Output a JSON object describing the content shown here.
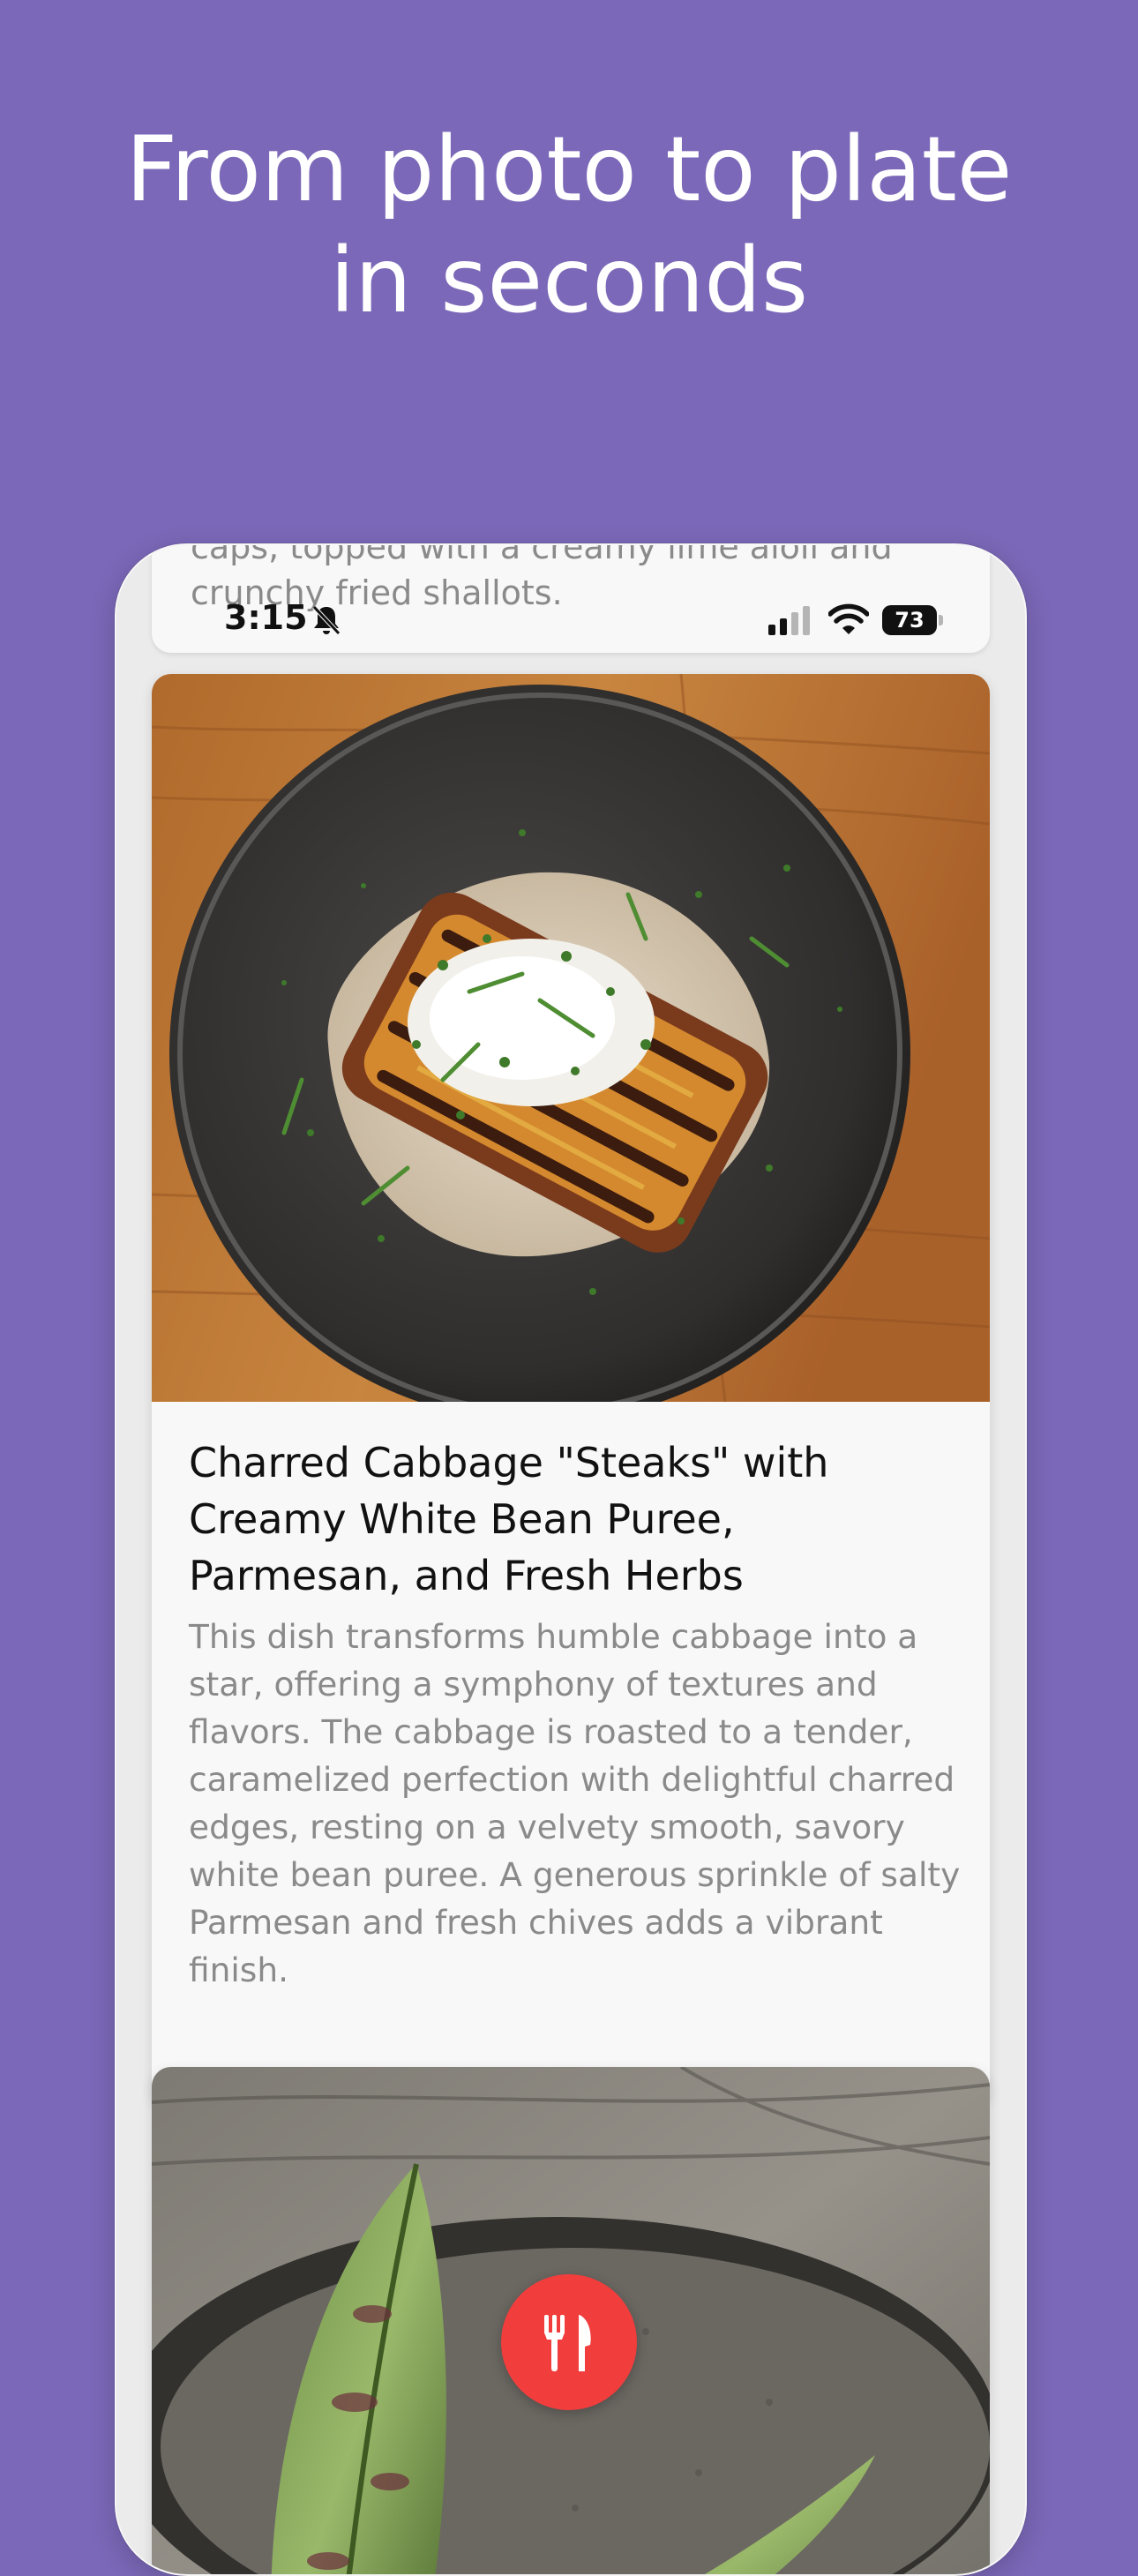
{
  "headline": {
    "line1": "From photo to plate",
    "line2": "in seconds"
  },
  "previous_card": {
    "text_line1": "caps, topped with a creamy lime aioli and",
    "text_line2": "crunchy fried shallots."
  },
  "status_bar": {
    "time": "3:15",
    "battery_level": "73",
    "icons": [
      "bell-off-icon",
      "signal-icon",
      "wifi-icon",
      "battery-icon"
    ]
  },
  "recipe": {
    "title": "Charred Cabbage \"Steaks\" with Creamy White Bean Puree, Parmesan, and Fresh Herbs",
    "description": "This dish transforms humble cabbage into a star, offering a symphony of textures and flavors. The cabbage is roasted to a tender, caramelized perfection with delightful charred edges, resting on a velvety smooth, savory white bean puree. A generous sprinkle of salty Parmesan and fresh chives adds a vibrant finish.",
    "photo": "charred-cabbage-dish-photo"
  },
  "next_recipe": {
    "photo": "leaf-wrapped-dish-photo"
  },
  "fab": {
    "icon": "utensils-icon"
  },
  "colors": {
    "background": "#7b68b8",
    "fab": "#f23d3d",
    "card": "#f8f8f8",
    "title_text": "#111111",
    "body_text": "#8a8a8a"
  }
}
